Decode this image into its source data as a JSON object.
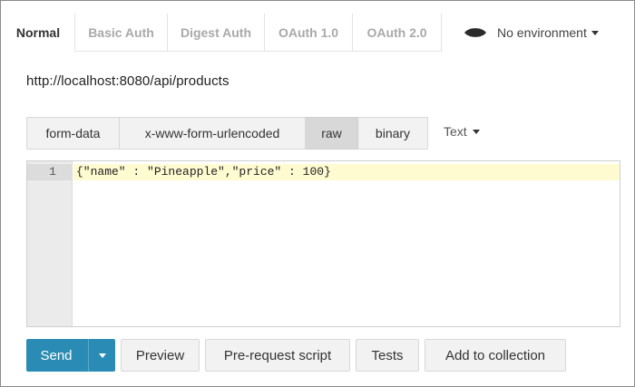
{
  "auth_tabs": [
    {
      "label": "Normal",
      "active": true
    },
    {
      "label": "Basic Auth",
      "active": false
    },
    {
      "label": "Digest Auth",
      "active": false
    },
    {
      "label": "OAuth 1.0",
      "active": false
    },
    {
      "label": "OAuth 2.0",
      "active": false
    }
  ],
  "environment": {
    "label": "No environment",
    "icon": "eye-icon"
  },
  "request": {
    "url": "http://localhost:8080/api/products"
  },
  "body_types": [
    {
      "label": "form-data",
      "active": false
    },
    {
      "label": "x-www-form-urlencoded",
      "active": false
    },
    {
      "label": "raw",
      "active": true
    },
    {
      "label": "binary",
      "active": false
    }
  ],
  "raw_format": {
    "label": "Text"
  },
  "editor": {
    "lines": [
      {
        "number": "1",
        "text": "{\"name\" : \"Pineapple\",\"price\" : 100}"
      }
    ]
  },
  "actions": {
    "send_label": "Send",
    "preview_label": "Preview",
    "prerequest_label": "Pre-request script",
    "tests_label": "Tests",
    "add_collection_label": "Add to collection"
  },
  "colors": {
    "send_button": "#2a8cb5",
    "active_line": "#fffbd1",
    "gutter": "#ebebeb"
  }
}
